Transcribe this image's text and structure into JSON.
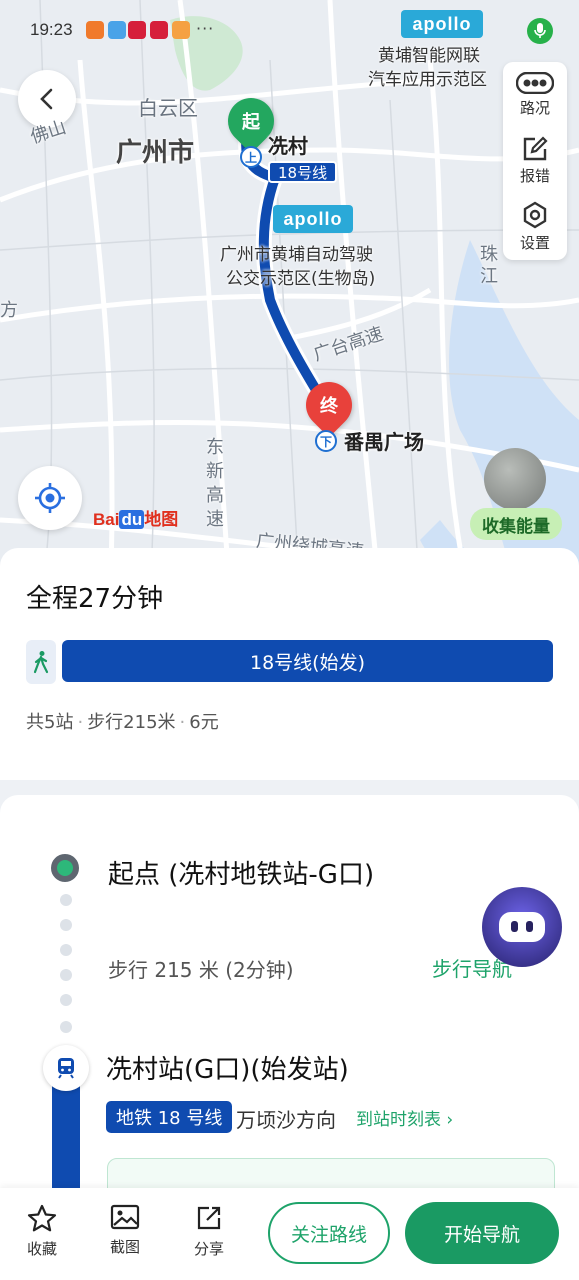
{
  "status": {
    "time": "19:23",
    "more": "···"
  },
  "map": {
    "apollo_top": "apollo",
    "apollo_top_caption_1": "黄埔智能网联",
    "apollo_top_caption_2": "汽车应用示范区",
    "apollo_mid": "apollo",
    "apollo_mid_caption_1": "广州市黄埔自动驾驶",
    "apollo_mid_caption_2": "公交示范区(生物岛)",
    "label_baiyun": "白云区",
    "label_guangzhou": "广州市",
    "label_foshan": "佛山",
    "label_zhujiang": "珠江",
    "label_fang": "方",
    "label_guangtai": "广台高速",
    "label_dongxin": "东新高速",
    "label_raocheng": "广州绕城高速",
    "start_pin": "起",
    "end_pin": "终",
    "start_station": "冼村",
    "end_station": "番禺广场",
    "line_tag": "18号线",
    "station_up": "上",
    "station_down": "下",
    "baidu_logo_a": "Bai",
    "baidu_logo_b": "du",
    "baidu_logo_c": "地图",
    "energy": "收集能量"
  },
  "right_panel": {
    "traffic": "路况",
    "report": "报错",
    "settings": "设置"
  },
  "summary": {
    "title": "全程27分钟",
    "line": "18号线(始发)",
    "stops": "共5站",
    "walk": "步行215米",
    "fare": "6元"
  },
  "details": {
    "start_title": "起点 (冼村地铁站-G口)",
    "walk_text": "步行 215 米 (2分钟)",
    "walk_nav": "步行导航",
    "station_title": "冼村站(G口)(始发站)",
    "metro_tag": "地铁 18 号线",
    "direction": "万顷沙方向",
    "timetable": "到站时刻表 ›"
  },
  "bottom": {
    "favorite": "收藏",
    "screenshot": "截图",
    "share": "分享",
    "follow": "关注路线",
    "start_nav": "开始导航"
  },
  "colors": {
    "route_blue": "#0f4bb0",
    "accent_green": "#1a9a63",
    "start_green": "#23a75f",
    "end_red": "#e8413b"
  }
}
